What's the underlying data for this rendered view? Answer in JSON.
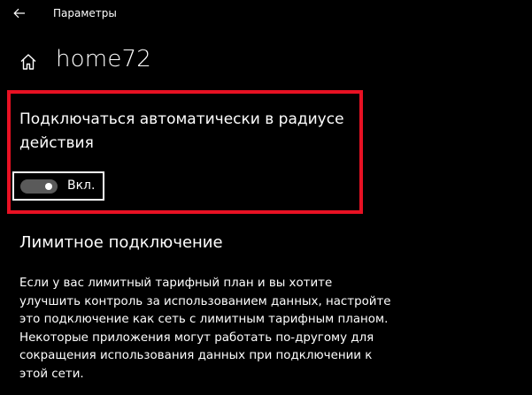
{
  "window": {
    "title": "Параметры"
  },
  "header": {
    "page_title": "home72"
  },
  "auto_connect": {
    "label": "Подключаться автоматически в радиусе действия",
    "toggle_state": true,
    "toggle_text": "Вкл."
  },
  "metered": {
    "heading": "Лимитное подключение",
    "description": "Если у вас лимитный тарифный план и вы хотите улучшить контроль за использованием данных, настройте это подключение как сеть с лимитным тарифным планом. Некоторые приложения могут работать по-другому для сокращения использования данных при подключении к этой сети."
  },
  "icons": {
    "back": "arrow-left-icon",
    "home": "home-icon"
  },
  "colors": {
    "background": "#000000",
    "text": "#ffffff",
    "highlight_border": "#e81123",
    "toggle_track": "#5a5a5a",
    "toggle_knob": "#ffffff"
  }
}
